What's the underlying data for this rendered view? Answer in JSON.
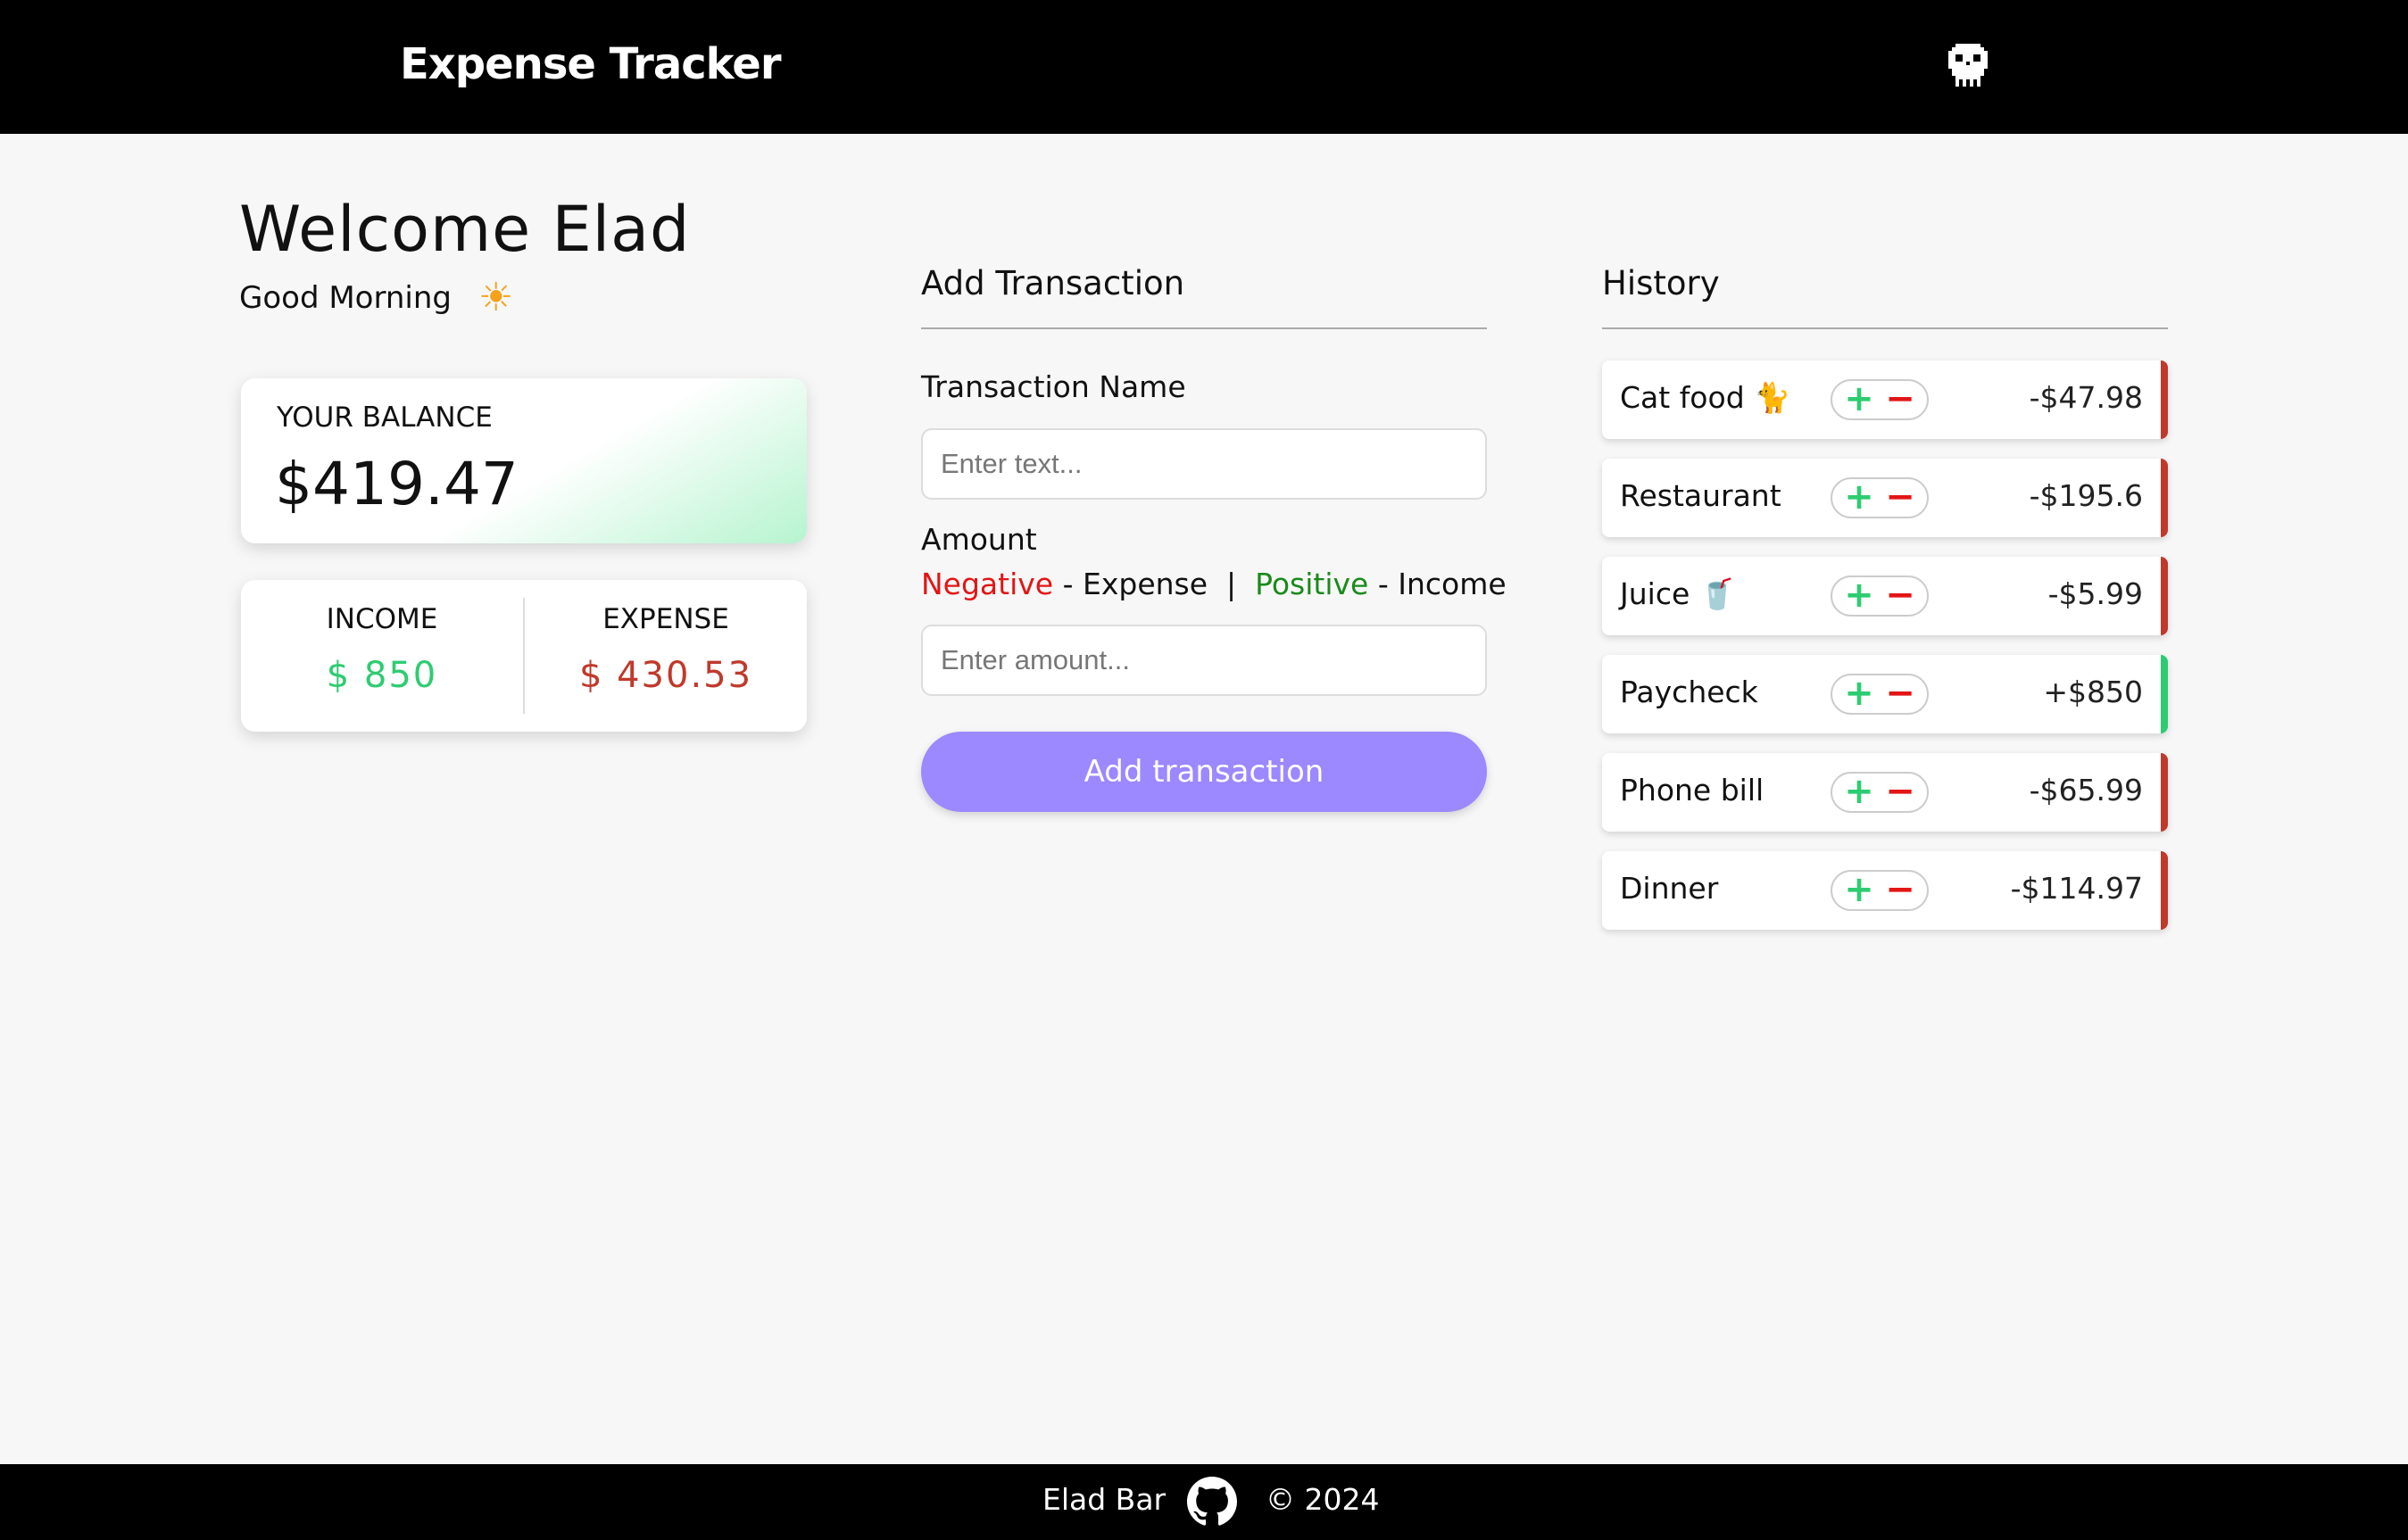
{
  "header": {
    "title": "Expense Tracker",
    "avatar_icon": "skull-icon"
  },
  "welcome": {
    "heading": "Welcome Elad",
    "greeting": "Good Morning",
    "greeting_icon": "sun-icon",
    "greeting_glyph": "☀"
  },
  "balance": {
    "label": "YOUR BALANCE",
    "value": "$419.47"
  },
  "summary": {
    "income_label": "INCOME",
    "income_value": "$ 850",
    "expense_label": "EXPENSE",
    "expense_value": "$ 430.53"
  },
  "add_form": {
    "title": "Add Transaction",
    "name_label": "Transaction Name",
    "name_placeholder": "Enter text...",
    "amount_label": "Amount",
    "hint_negative": "Negative",
    "hint_expense": " - Expense  |  ",
    "hint_positive": "Positive",
    "hint_income": " - Income",
    "amount_placeholder": "Enter amount...",
    "submit_label": "Add transaction"
  },
  "history": {
    "title": "History",
    "items": [
      {
        "name": "Cat food 🐈",
        "amount": "-$47.98",
        "type": "expense"
      },
      {
        "name": "Restaurant",
        "amount": "-$195.6",
        "type": "expense"
      },
      {
        "name": "Juice 🥤",
        "amount": "-$5.99",
        "type": "expense"
      },
      {
        "name": "Paycheck",
        "amount": "+$850",
        "type": "income"
      },
      {
        "name": "Phone bill",
        "amount": "-$65.99",
        "type": "expense"
      },
      {
        "name": "Dinner",
        "amount": "-$114.97",
        "type": "expense"
      }
    ],
    "plus_glyph": "+",
    "minus_glyph": "−"
  },
  "footer": {
    "name": "Elad Bar",
    "icon": "github-icon",
    "copyright": "© 2024"
  },
  "colors": {
    "income": "#2ecc71",
    "expense": "#c0392b",
    "accent": "#9c88ff",
    "header_bg": "#000000"
  }
}
